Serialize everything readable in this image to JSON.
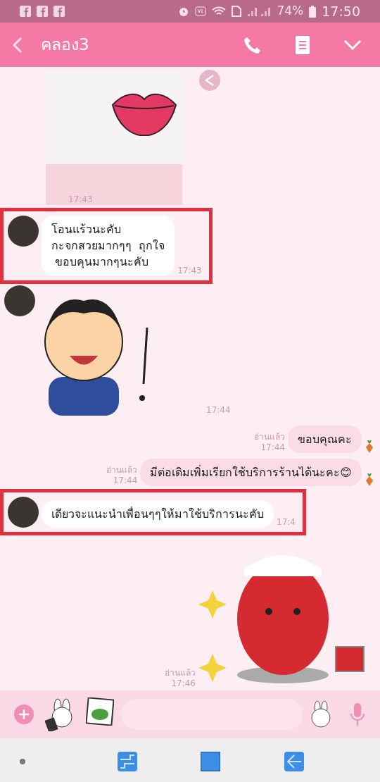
{
  "status_bar": {
    "battery": "74%",
    "time": "17:50"
  },
  "header": {
    "title": "คลอง3"
  },
  "messages": [
    {
      "kind": "image",
      "outgoing": false,
      "time": "17:43"
    },
    {
      "kind": "text",
      "outgoing": false,
      "highlighted": true,
      "lines": [
        "โอนแร้วนะคับ",
        "กะจกสวยมากๆๆ  ถุกใจ",
        " ขอบคุนมากๆนะคับ"
      ],
      "time": "17:43"
    },
    {
      "kind": "sticker",
      "outgoing": false,
      "time": "17:44"
    },
    {
      "kind": "text",
      "outgoing": true,
      "read": "อ่านแล้ว",
      "lines": [
        "ขอบคุณคะ"
      ],
      "time": "17:44"
    },
    {
      "kind": "text",
      "outgoing": true,
      "read": "อ่านแล้ว",
      "lines": [
        "มีต่อเดิมเพิ่มเรียกใช้บริการร้านได้นะคะ😊"
      ],
      "time": "17:44"
    },
    {
      "kind": "text",
      "outgoing": false,
      "highlighted": true,
      "lines": [
        "เดียวจะแนะนำเพื่อนๆๆให้มาใช้บริการนะคับ"
      ],
      "time": "17:4"
    },
    {
      "kind": "sticker",
      "outgoing": true,
      "read": "อ่านแล้ว",
      "time": "17:46"
    }
  ]
}
